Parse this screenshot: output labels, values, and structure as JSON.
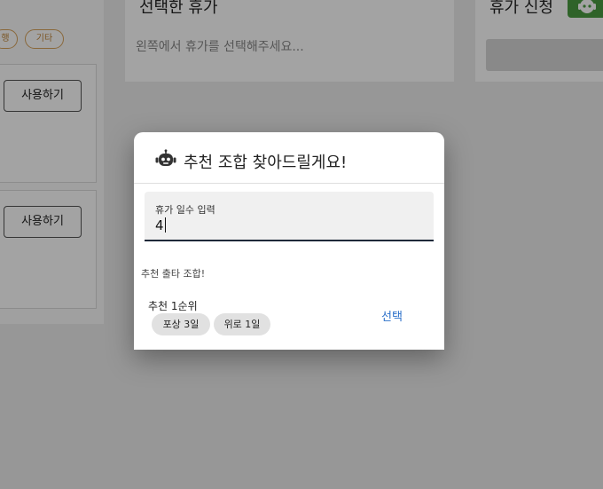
{
  "filters": {
    "partial_tag": "행",
    "etc_tag": "기타"
  },
  "cards": [
    {
      "use_label": "사용하기"
    },
    {
      "use_label": "사용하기"
    }
  ],
  "selected_panel": {
    "title": "선택한 휴가",
    "empty_message": "왼쪽에서 휴가를 선택해주세요..."
  },
  "apply_panel": {
    "title": "휴가 신청",
    "icon": "robot-icon",
    "accent_color": "#4a9b40"
  },
  "dialog": {
    "icon": "robot-icon",
    "title": "추천 조합 찾아드릴게요!",
    "input": {
      "label": "휴가 일수 입력",
      "value": "4"
    },
    "section_title": "추천 출타 조합!",
    "recommendations": [
      {
        "rank_label": "추천 1순위",
        "chips": [
          "포상 3일",
          "위로 1일"
        ],
        "action_label": "선택"
      }
    ],
    "link_color": "#2a6fc9"
  }
}
